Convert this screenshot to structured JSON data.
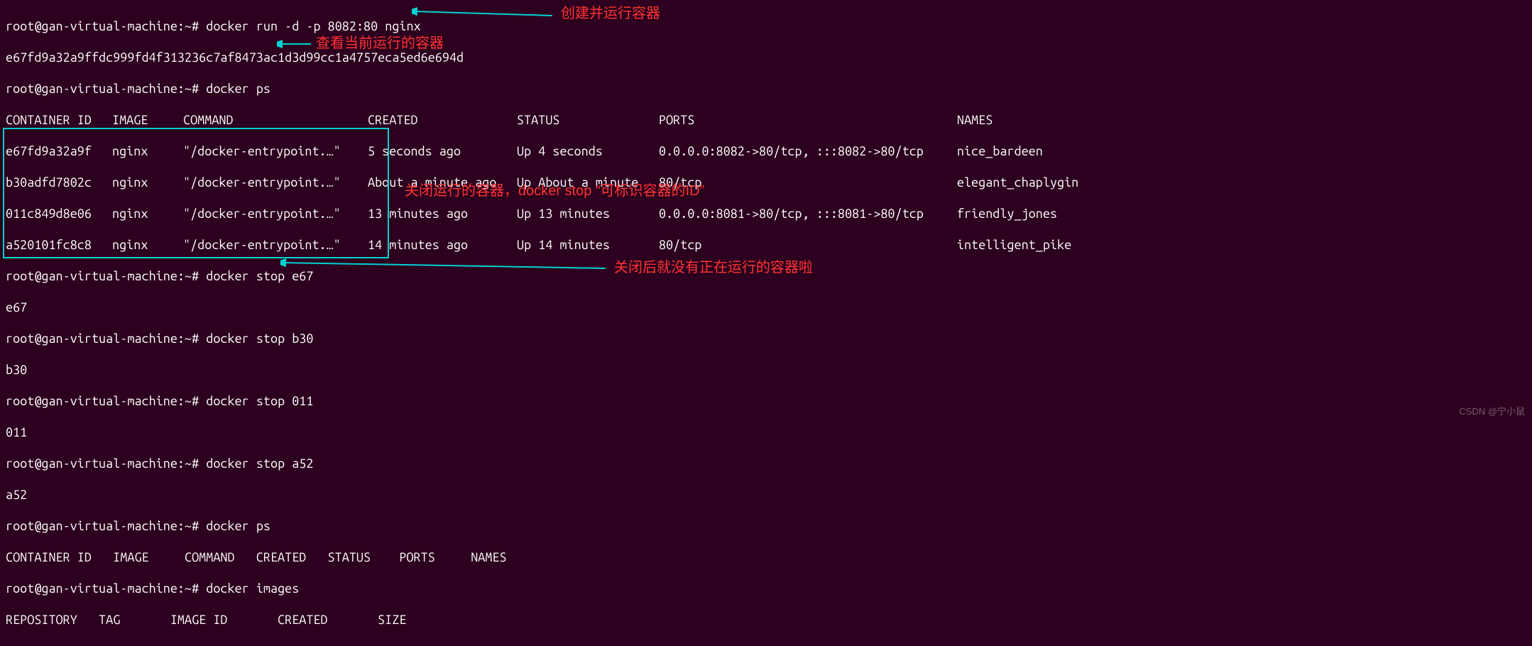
{
  "prompt": "root@gan-virtual-machine:~#",
  "cmd_run": "docker run -d -p 8082:80 nginx",
  "container_hash": "e67fd9a32a9ffdc999fd4f313236c7af8473ac1d3d99cc1a4757eca5ed6e694d",
  "cmd_ps1": "docker ps",
  "ps_header": {
    "cid": "CONTAINER ID",
    "image": "IMAGE",
    "command": "COMMAND",
    "created": "CREATED",
    "status": "STATUS",
    "ports": "PORTS",
    "names": "NAMES"
  },
  "ps_rows": [
    {
      "cid": "e67fd9a32a9f",
      "image": "nginx",
      "command": "\"/docker-entrypoint.…\"",
      "created": "5 seconds ago",
      "status": "Up 4 seconds",
      "ports": "0.0.0.0:8082->80/tcp, :::8082->80/tcp",
      "names": "nice_bardeen"
    },
    {
      "cid": "b30adfd7802c",
      "image": "nginx",
      "command": "\"/docker-entrypoint.…\"",
      "created": "About a minute ago",
      "status": "Up About a minute",
      "ports": "80/tcp",
      "names": "elegant_chaplygin"
    },
    {
      "cid": "011c849d8e06",
      "image": "nginx",
      "command": "\"/docker-entrypoint.…\"",
      "created": "13 minutes ago",
      "status": "Up 13 minutes",
      "ports": "0.0.0.0:8081->80/tcp, :::8081->80/tcp",
      "names": "friendly_jones"
    },
    {
      "cid": "a520101fc8c8",
      "image": "nginx",
      "command": "\"/docker-entrypoint.…\"",
      "created": "14 minutes ago",
      "status": "Up 14 minutes",
      "ports": "80/tcp",
      "names": "intelligent_pike"
    }
  ],
  "stops": [
    {
      "cmd": "docker stop e67",
      "out": "e67"
    },
    {
      "cmd": "docker stop b30",
      "out": "b30"
    },
    {
      "cmd": "docker stop 011",
      "out": "011"
    },
    {
      "cmd": "docker stop a52",
      "out": "a52"
    }
  ],
  "cmd_ps2": "docker ps",
  "ps2_header": "CONTAINER ID   IMAGE     COMMAND   CREATED   STATUS    PORTS     NAMES",
  "cmd_images": "docker images",
  "images_header": "REPOSITORY   TAG       IMAGE ID       CREATED       SIZE",
  "annotations": {
    "a1": "创建并运行容器",
    "a2": "查看当前运行的容器",
    "a3": "关闭运行的容器，docker stop “可标识容器的ID”",
    "a4": "关闭后就没有正在运行的容器啦"
  },
  "watermark": "CSDN @宁小鼠"
}
